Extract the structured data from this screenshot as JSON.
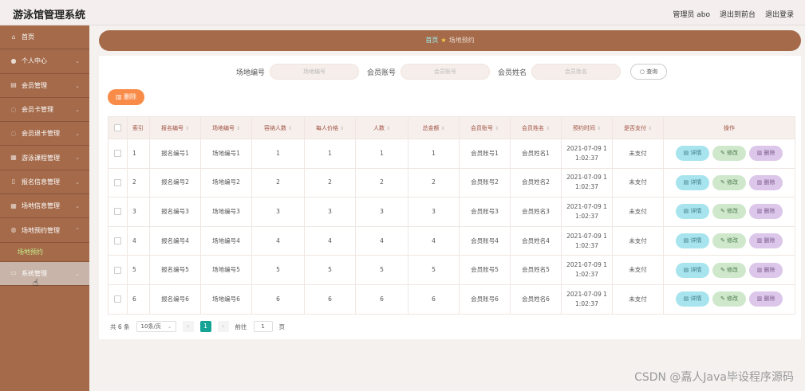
{
  "app": {
    "title": "游泳馆管理系统"
  },
  "header": {
    "user": "管理员 abo",
    "front": "退出到前台",
    "logout": "退出登录"
  },
  "sidebar": {
    "items": [
      {
        "label": "首页",
        "icon": "home-icon",
        "glyph": "⌂"
      },
      {
        "label": "个人中心",
        "icon": "user-icon",
        "glyph": "●"
      },
      {
        "label": "会员管理",
        "icon": "member-icon",
        "glyph": "▤"
      },
      {
        "label": "会员卡管理",
        "icon": "card-icon",
        "glyph": "◌"
      },
      {
        "label": "会员退卡管理",
        "icon": "return-icon",
        "glyph": "◌"
      },
      {
        "label": "游泳课程管理",
        "icon": "course-icon",
        "glyph": "▦"
      },
      {
        "label": "报名信息管理",
        "icon": "signup-icon",
        "glyph": "▯"
      },
      {
        "label": "场地信息管理",
        "icon": "venue-icon",
        "glyph": "▦"
      },
      {
        "label": "场地预约管理",
        "icon": "reserve-icon",
        "glyph": "◍"
      }
    ],
    "submenu": "场地预约",
    "system": {
      "label": "系统管理",
      "icon": "settings-icon",
      "glyph": "▭"
    }
  },
  "breadcrumb": {
    "home": "首页",
    "current": "场地预约"
  },
  "search": {
    "field1_label": "场地编号",
    "field1_placeholder": "场地编号",
    "field2_label": "会员账号",
    "field2_placeholder": "会员账号",
    "field3_label": "会员姓名",
    "field3_placeholder": "会员姓名",
    "button": "查询"
  },
  "toolbar": {
    "delete": "删除"
  },
  "table": {
    "headers": [
      "索引",
      "报名编号",
      "场地编号",
      "容纳人数",
      "每人价格",
      "人数",
      "总金额",
      "会员账号",
      "会员姓名",
      "预约时间",
      "是否支付",
      "操作"
    ],
    "rows": [
      {
        "idx": "1",
        "signup": "报名编号1",
        "venue": "场地编号1",
        "capacity": "1",
        "price": "1",
        "people": "1",
        "total": "1",
        "account": "会员账号1",
        "name": "会员姓名1",
        "time1": "2021-07-09 1",
        "time2": "1:02:37",
        "paid": "未支付"
      },
      {
        "idx": "2",
        "signup": "报名编号2",
        "venue": "场地编号2",
        "capacity": "2",
        "price": "2",
        "people": "2",
        "total": "2",
        "account": "会员账号2",
        "name": "会员姓名2",
        "time1": "2021-07-09 1",
        "time2": "1:02:37",
        "paid": "未支付"
      },
      {
        "idx": "3",
        "signup": "报名编号3",
        "venue": "场地编号3",
        "capacity": "3",
        "price": "3",
        "people": "3",
        "total": "3",
        "account": "会员账号3",
        "name": "会员姓名3",
        "time1": "2021-07-09 1",
        "time2": "1:02:37",
        "paid": "未支付"
      },
      {
        "idx": "4",
        "signup": "报名编号4",
        "venue": "场地编号4",
        "capacity": "4",
        "price": "4",
        "people": "4",
        "total": "4",
        "account": "会员账号4",
        "name": "会员姓名4",
        "time1": "2021-07-09 1",
        "time2": "1:02:37",
        "paid": "未支付"
      },
      {
        "idx": "5",
        "signup": "报名编号5",
        "venue": "场地编号5",
        "capacity": "5",
        "price": "5",
        "people": "5",
        "total": "5",
        "account": "会员账号5",
        "name": "会员姓名5",
        "time1": "2021-07-09 1",
        "time2": "1:02:37",
        "paid": "未支付"
      },
      {
        "idx": "6",
        "signup": "报名编号6",
        "venue": "场地编号6",
        "capacity": "6",
        "price": "6",
        "people": "6",
        "total": "6",
        "account": "会员账号6",
        "name": "会员姓名6",
        "time1": "2021-07-09 1",
        "time2": "1:02:37",
        "paid": "未支付"
      }
    ],
    "ops": {
      "detail": "详情",
      "edit": "修改",
      "remove": "删除"
    }
  },
  "pager": {
    "total": "共 6 条",
    "size": "10条/页",
    "prev": "‹",
    "page": "1",
    "next": "›",
    "goto_label": "前往",
    "goto_value": "1",
    "goto_suffix": "页"
  },
  "watermark": "CSDN @嘉人Java毕设程序源码",
  "colors": {
    "sidebar": "#a46a4a",
    "delete": "#f98b48",
    "page_active": "#15a395"
  }
}
